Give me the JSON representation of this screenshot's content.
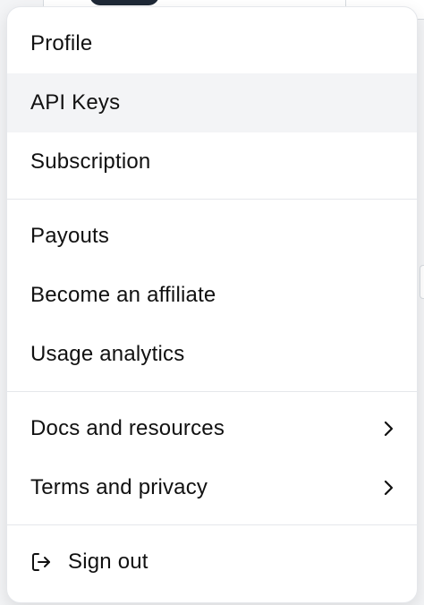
{
  "menu": {
    "items_group_1": [
      {
        "label": "Profile"
      },
      {
        "label": "API Keys"
      },
      {
        "label": "Subscription"
      }
    ],
    "items_group_2": [
      {
        "label": "Payouts"
      },
      {
        "label": "Become an affiliate"
      },
      {
        "label": "Usage analytics"
      }
    ],
    "items_group_3": [
      {
        "label": "Docs and resources",
        "icon": "chevron-right-icon"
      },
      {
        "label": "Terms and privacy",
        "icon": "chevron-right-icon"
      }
    ],
    "sign_out": {
      "label": "Sign out",
      "icon": "sign-out-icon"
    }
  },
  "colors": {
    "menu_background": "#ffffff",
    "highlight": "#f3f4f6",
    "separator": "#e5e7eb",
    "text": "#111111"
  }
}
